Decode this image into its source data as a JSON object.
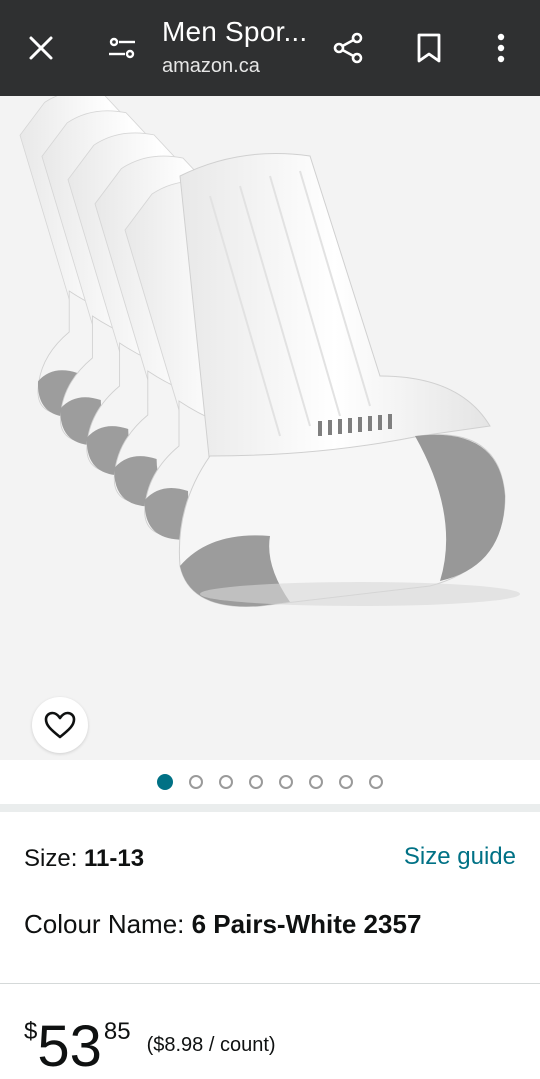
{
  "topbar": {
    "title": "Men Spor...",
    "subtitle": "amazon.ca",
    "icons": [
      "close-icon",
      "tune-icon",
      "share-icon",
      "bookmark-icon",
      "more-vert-icon"
    ]
  },
  "gallery": {
    "image_description_icon": "socks-image",
    "favorite_icon": "heart-outline-icon",
    "dots_total": 8,
    "dots_active_index": 0
  },
  "product": {
    "size_label": "Size: ",
    "size_value": "11-13",
    "size_guide": "Size guide",
    "colour_label": "Colour Name: ",
    "colour_value": "6 Pairs-White 2357"
  },
  "price": {
    "currency": "$",
    "whole": "53",
    "fraction": "85",
    "unit_price": "($8.98 / count)"
  },
  "colors": {
    "topbar": "#2f3031",
    "accent": "#007185"
  }
}
